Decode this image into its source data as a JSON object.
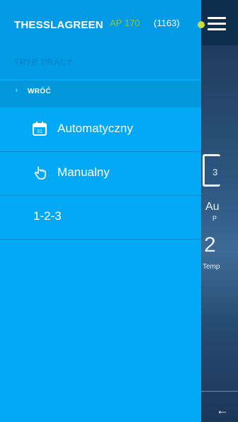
{
  "app": {
    "brand": "THESSLAGREEN",
    "model": "AP 170",
    "count": "(1163)"
  },
  "drawer": {
    "section_label": "TRYB PRACY",
    "back_label": "WRÓĆ",
    "items": [
      {
        "label": "Automatyczny",
        "icon": "calendar-icon"
      },
      {
        "label": "Manualny",
        "icon": "hand-pointer-icon"
      },
      {
        "label": "1-2-3",
        "icon": ""
      }
    ]
  },
  "background": {
    "calendar_day": "3",
    "mode_text": "Au",
    "mode_sub": "P",
    "temp_value": "2",
    "temp_label": "Temp"
  },
  "colors": {
    "drawer": "#03a9f4",
    "top_bar": "#039be5",
    "model_green": "#8bc34a",
    "status_dot": "#cddc39"
  }
}
